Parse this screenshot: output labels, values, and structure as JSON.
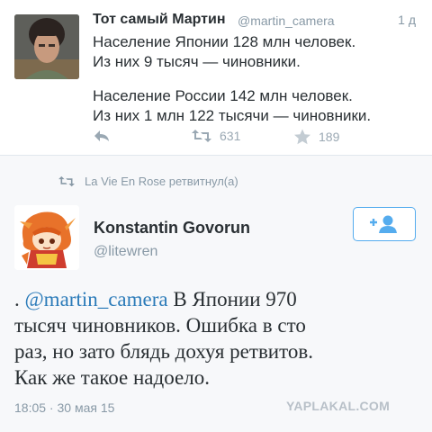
{
  "tweet1": {
    "author_name": "Тот самый Мартин",
    "author_handle": "@martin_camera",
    "time": "1 д",
    "lines": [
      "Население Японии 128 млн человек.",
      "Из них 9 тысяч — чиновники.",
      "Население России 142 млн человек.",
      "Из них 1 млн 122 тысячи — чиновники."
    ],
    "retweets": "631",
    "favorites": "189"
  },
  "retweet_notice": "La Vie En Rose ретвитнул(а)",
  "tweet2": {
    "author_name": "Konstantin Govorun",
    "author_handle": "@litewren",
    "text_prefix": ". ",
    "mention": "@martin_camera",
    "text_line1_rest": " В Японии 970",
    "text_line2": "тысяч чиновников. Ошибка в сто",
    "text_line3": "раз, но зато блядь дохуя ретвитов.",
    "text_line4": "Как же такое надоело.",
    "date": "18:05 · 30 мая 15"
  },
  "watermark": "YAPLAKAL.COM",
  "colors": {
    "link": "#2b7bb9",
    "muted": "#8899a6",
    "follow_accent": "#55acee"
  },
  "icons": {
    "reply": "reply-icon",
    "retweet": "retweet-icon",
    "favorite": "star-icon",
    "follow": "follow-user-icon"
  }
}
